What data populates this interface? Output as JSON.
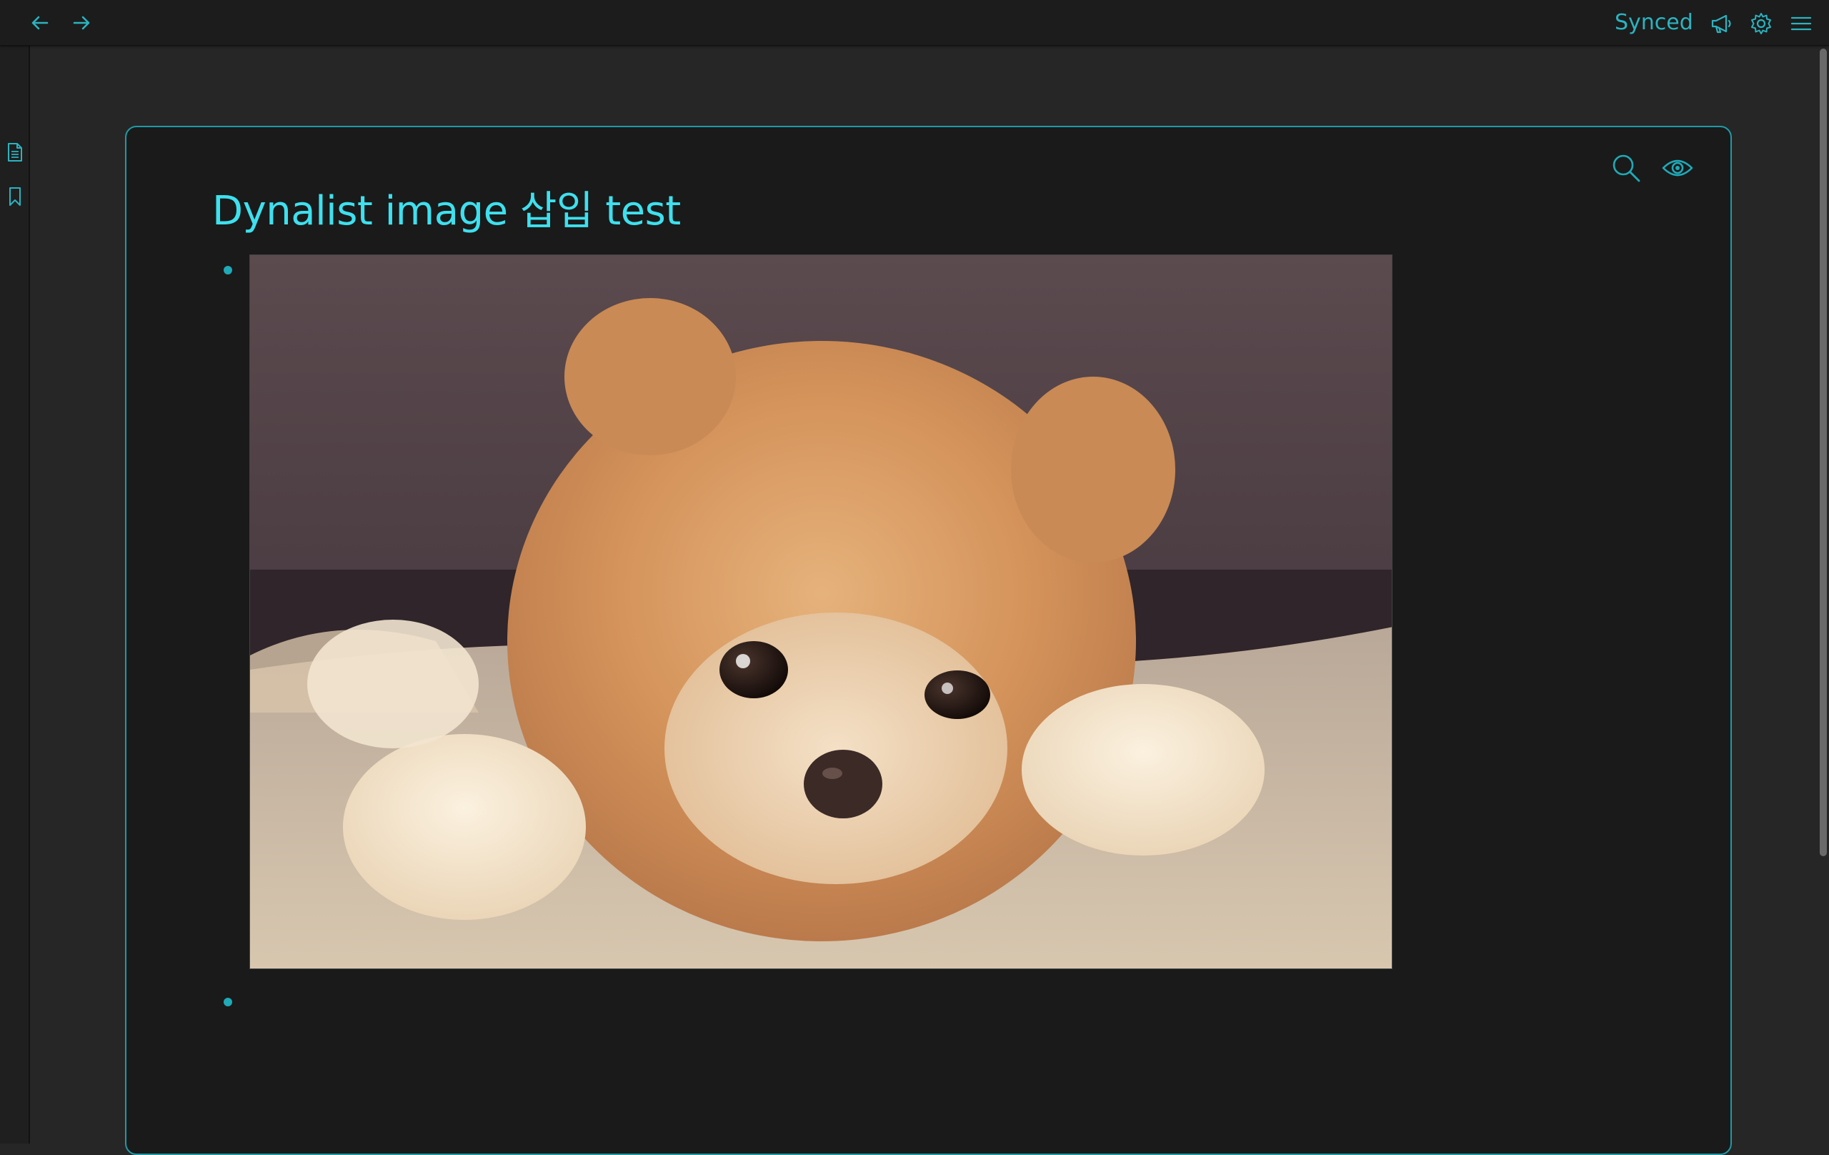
{
  "topbar": {
    "sync_status": "Synced"
  },
  "document": {
    "title": "Dynalist image 삽입 test"
  },
  "colors": {
    "accent": "#1faab8",
    "title": "#3ee0ee",
    "panel_bg": "#1a1a1a",
    "page_bg": "#262626"
  },
  "icons": {
    "back": "arrow-left-icon",
    "forward": "arrow-right-icon",
    "announcements": "megaphone-icon",
    "settings": "gear-icon",
    "menu": "hamburger-menu-icon",
    "document": "document-icon",
    "bookmark": "bookmark-icon",
    "search": "search-icon",
    "view_mode": "eye-icon"
  }
}
